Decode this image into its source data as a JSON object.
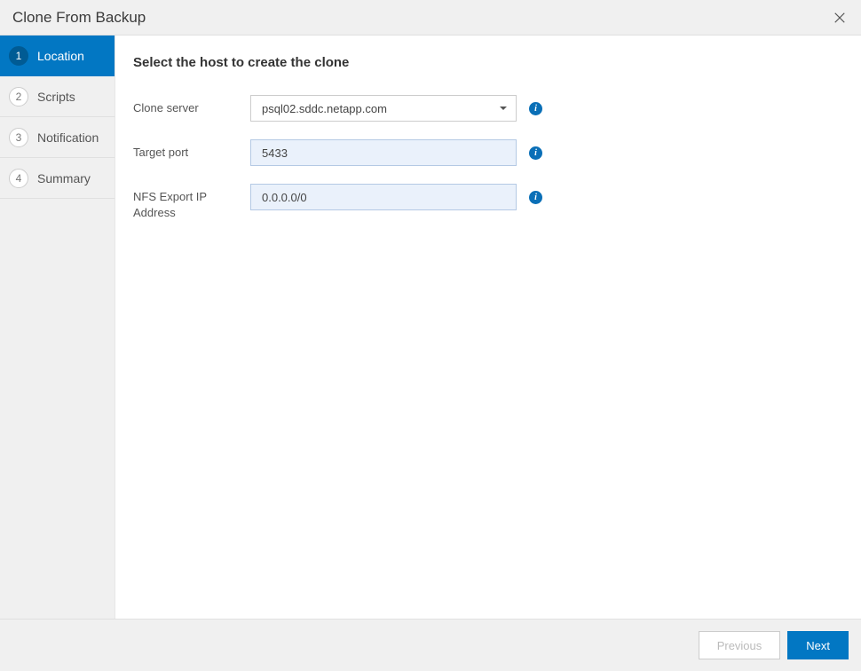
{
  "header": {
    "title": "Clone From Backup"
  },
  "sidebar": {
    "steps": [
      {
        "num": "1",
        "label": "Location"
      },
      {
        "num": "2",
        "label": "Scripts"
      },
      {
        "num": "3",
        "label": "Notification"
      },
      {
        "num": "4",
        "label": "Summary"
      }
    ]
  },
  "content": {
    "title": "Select the host to create the clone",
    "fields": {
      "clone_server": {
        "label": "Clone server",
        "value": "psql02.sddc.netapp.com"
      },
      "target_port": {
        "label": "Target port",
        "value": "5433"
      },
      "nfs_export": {
        "label": "NFS Export IP Address",
        "value": "0.0.0.0/0"
      }
    }
  },
  "footer": {
    "previous": "Previous",
    "next": "Next"
  }
}
